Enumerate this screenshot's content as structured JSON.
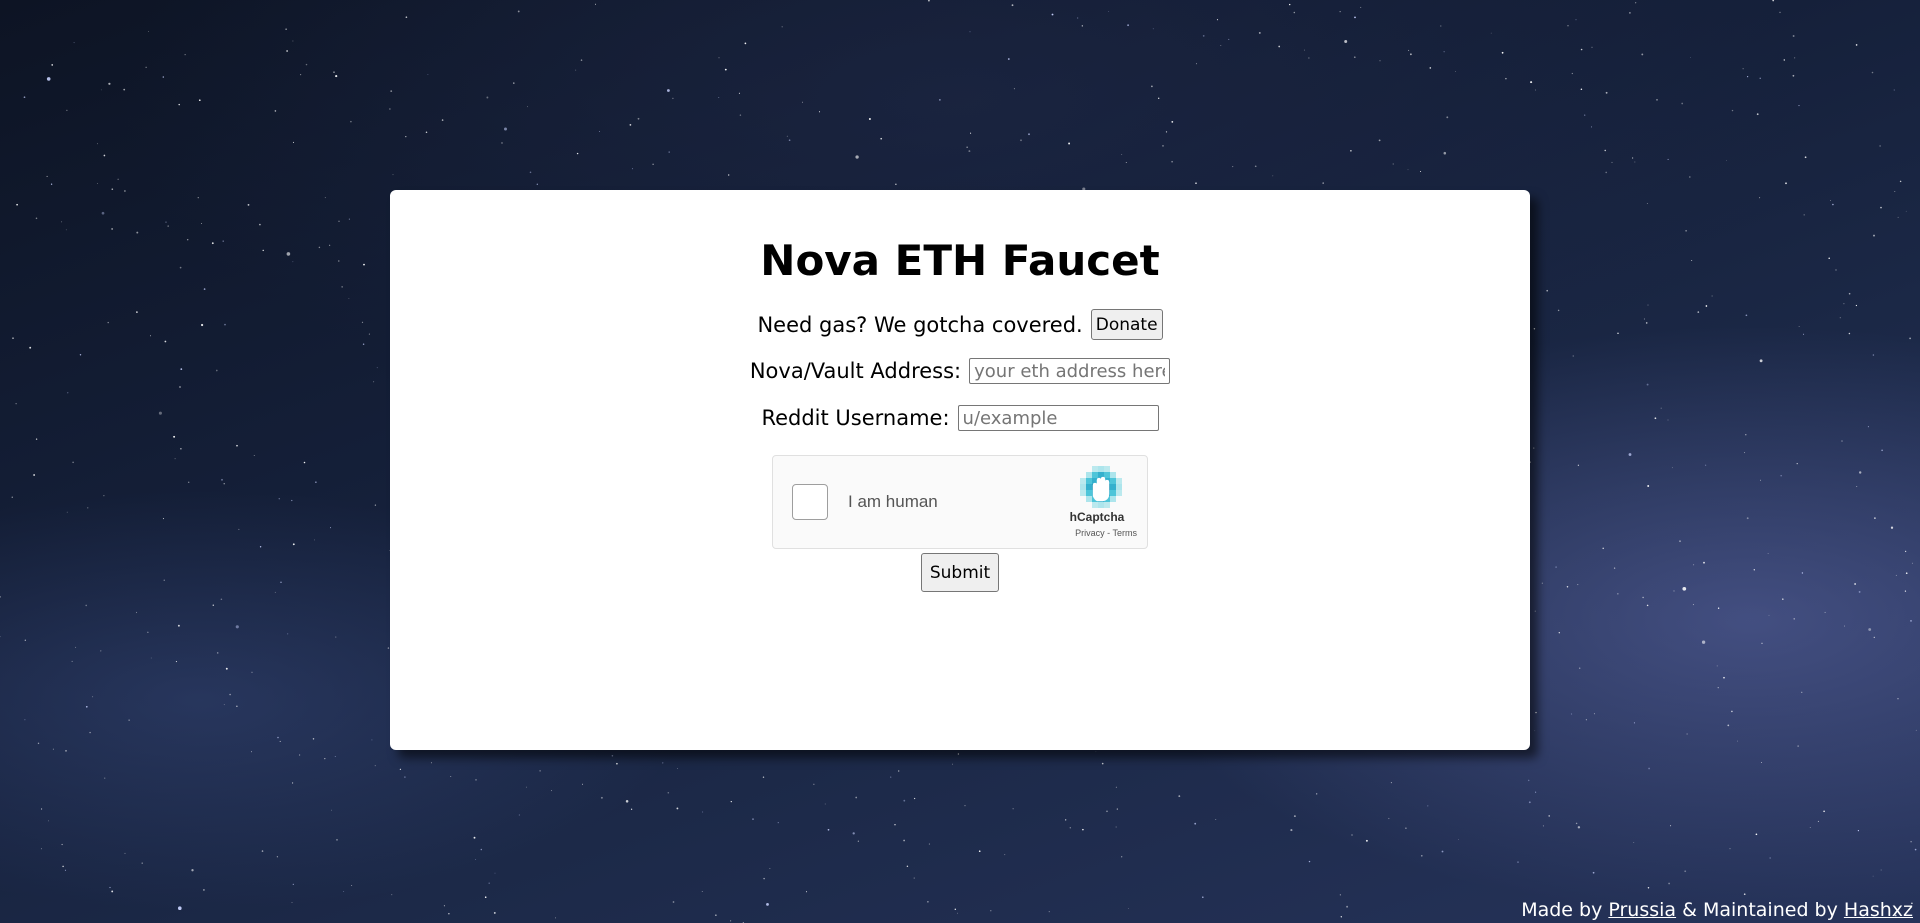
{
  "page": {
    "title": "Nova ETH Faucet",
    "tagline": "Need gas? We gotcha covered.",
    "donate_label": "Donate"
  },
  "form": {
    "address_label": "Nova/Vault Address:",
    "address_placeholder": "your eth address here",
    "address_value": "",
    "reddit_label": "Reddit Username:",
    "reddit_placeholder": "u/example",
    "reddit_value": "",
    "submit_label": "Submit"
  },
  "captcha": {
    "checkbox_label": "I am human",
    "brand": "hCaptcha",
    "privacy_link": "Privacy",
    "separator": "-",
    "terms_link": "Terms",
    "checked": false
  },
  "footer": {
    "prefix": "Made by",
    "author": "Prussia",
    "middle": "& Maintained by",
    "maintainer": "Hashxz"
  },
  "colors": {
    "card_background": "#ffffff",
    "background_dark": "#0d1424",
    "captcha_logo_primary": "#1fa9c9",
    "captcha_logo_secondary": "#6dd3e0"
  },
  "icons": {
    "captcha_logo": "hcaptcha-hand-icon"
  }
}
